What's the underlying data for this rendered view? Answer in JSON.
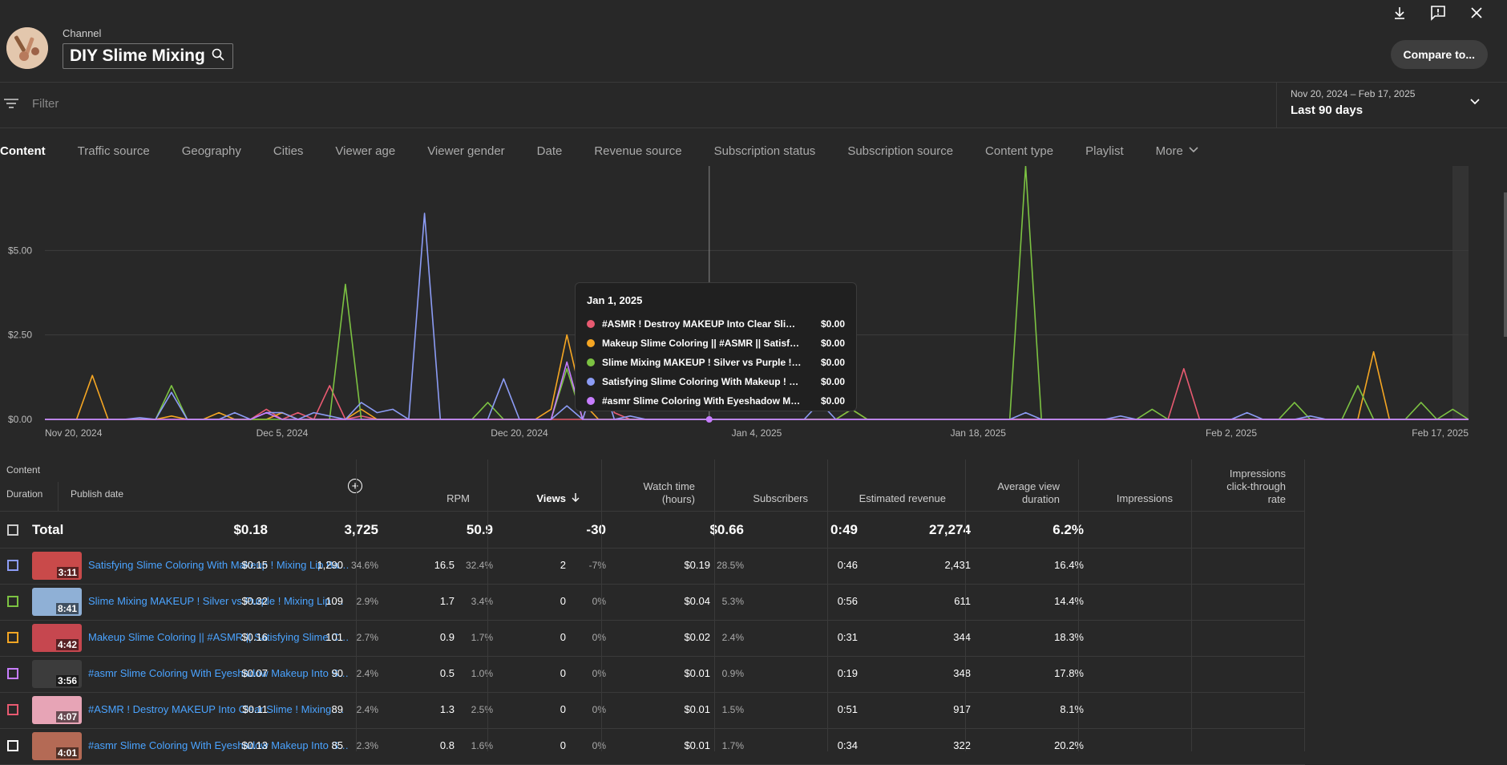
{
  "header": {
    "channel_label": "Channel",
    "channel_name": "DIY Slime Mixing",
    "compare_button": "Compare to...",
    "icons": [
      "download-icon",
      "feedback-icon",
      "close-icon"
    ]
  },
  "filter": {
    "placeholder": "Filter"
  },
  "date_range": {
    "range": "Nov 20, 2024 – Feb 17, 2025",
    "preset": "Last 90 days"
  },
  "tabs": [
    {
      "label": "Content",
      "active": true
    },
    {
      "label": "Traffic source"
    },
    {
      "label": "Geography"
    },
    {
      "label": "Cities"
    },
    {
      "label": "Viewer age"
    },
    {
      "label": "Viewer gender"
    },
    {
      "label": "Date"
    },
    {
      "label": "Revenue source"
    },
    {
      "label": "Subscription status"
    },
    {
      "label": "Subscription source"
    },
    {
      "label": "Content type"
    },
    {
      "label": "Playlist"
    },
    {
      "label": "More"
    }
  ],
  "colors": {
    "red": "#e85a71",
    "orange": "#f5a623",
    "green": "#7cc242",
    "blue": "#8c9cf5",
    "purple": "#c77dff",
    "accent": "#4aa3ff"
  },
  "chart_data": {
    "type": "line",
    "ylabel": "",
    "y_ticks": [
      "$0.00",
      "$2.50",
      "$5.00"
    ],
    "ylim": [
      0,
      7.5
    ],
    "x_ticks": [
      "Nov 20, 2024",
      "Dec 5, 2024",
      "Dec 20, 2024",
      "Jan 4, 2025",
      "Jan 18, 2025",
      "Feb 2, 2025",
      "Feb 17, 2025"
    ],
    "x_days": 90,
    "hover_day": 42,
    "grid": true,
    "series": [
      {
        "name": "#ASMR ! Destroy MAKEUP Into Clear Slime ! Mixing Makeup",
        "color": "#e85a71",
        "spikes": [
          [
            14,
            0.3
          ],
          [
            16,
            0.2
          ],
          [
            18,
            1.0
          ],
          [
            20,
            0.1
          ],
          [
            35,
            1.5
          ],
          [
            36,
            0.2
          ],
          [
            72,
            1.5
          ]
        ]
      },
      {
        "name": "Makeup Slime Coloring || #ASMR || Satisfying Slime Coloring",
        "color": "#f5a623",
        "spikes": [
          [
            3,
            1.3
          ],
          [
            8,
            0.1
          ],
          [
            11,
            0.2
          ],
          [
            15,
            0.2
          ],
          [
            20,
            0.3
          ],
          [
            32,
            0.3
          ],
          [
            33,
            2.5
          ],
          [
            34,
            0.5
          ],
          [
            51,
            0.3
          ],
          [
            84,
            2.0
          ]
        ]
      },
      {
        "name": "Slime Mixing MAKEUP ! Silver vs Purple ! Mixing Lip Balm",
        "color": "#7cc242",
        "spikes": [
          [
            8,
            1.0
          ],
          [
            19,
            4.0
          ],
          [
            28,
            0.5
          ],
          [
            33,
            1.5
          ],
          [
            51,
            0.3
          ],
          [
            62,
            7.5
          ],
          [
            70,
            0.3
          ],
          [
            79,
            0.5
          ],
          [
            83,
            1.0
          ],
          [
            87,
            0.5
          ],
          [
            89,
            0.3
          ]
        ]
      },
      {
        "name": "Satisfying Slime Coloring With Makeup ! Mixing Lip Balm",
        "color": "#8c9cf5",
        "spikes": [
          [
            6,
            0.05
          ],
          [
            8,
            0.8
          ],
          [
            12,
            0.2
          ],
          [
            14,
            0.2
          ],
          [
            15,
            0.2
          ],
          [
            17,
            0.2
          ],
          [
            18,
            0.1
          ],
          [
            20,
            0.5
          ],
          [
            21,
            0.2
          ],
          [
            22,
            0.3
          ],
          [
            24,
            6.1
          ],
          [
            29,
            1.2
          ],
          [
            33,
            0.4
          ],
          [
            35,
            1.5
          ],
          [
            37,
            0.1
          ],
          [
            49,
            0.5
          ],
          [
            62,
            0.2
          ],
          [
            68,
            0.1
          ],
          [
            76,
            0.2
          ],
          [
            80,
            0.1
          ]
        ]
      },
      {
        "name": "#asmr Slime Coloring With Eyeshadow Makeup Into Slime",
        "color": "#c77dff",
        "spikes": [
          [
            14,
            0.2
          ],
          [
            33,
            1.7
          ]
        ]
      }
    ],
    "tooltip": {
      "date": "Jan 1, 2025",
      "rows": [
        {
          "label": "#ASMR ! Destroy MAKEUP Into Clear Slime ! Mixing Makeup",
          "value": "$0.00",
          "color": "#e85a71"
        },
        {
          "label": "Makeup Slime Coloring || #ASMR || Satisfying Slime Coloring",
          "value": "$0.00",
          "color": "#f5a623"
        },
        {
          "label": "Slime Mixing MAKEUP ! Silver vs Purple ! Mixing Lip Balm",
          "value": "$0.00",
          "color": "#7cc242"
        },
        {
          "label": "Satisfying Slime Coloring With Makeup ! Mixing Lip Balm",
          "value": "$0.00",
          "color": "#8c9cf5"
        },
        {
          "label": "#asmr Slime Coloring With Eyeshadow Makeup Into Slime",
          "value": "$0.00",
          "color": "#c77dff"
        }
      ]
    }
  },
  "table": {
    "content_header": "Content",
    "duration_header": "Duration",
    "publish_header": "Publish date",
    "columns": {
      "rpm": "RPM",
      "views": "Views",
      "watch_l1": "Watch time",
      "watch_l2": "(hours)",
      "subs": "Subscribers",
      "revenue": "Estimated revenue",
      "avd_l1": "Average view",
      "avd_l2": "duration",
      "impr": "Impressions",
      "ctr_l1": "Impressions",
      "ctr_l2": "click-through",
      "ctr_l3": "rate"
    },
    "total": {
      "label": "Total",
      "rpm": "$0.18",
      "views": "3,725",
      "watch": "50.9",
      "subs": "-30",
      "revenue": "$0.66",
      "avd": "0:49",
      "impr": "27,274",
      "ctr": "6.2%"
    },
    "rows": [
      {
        "title": "Satisfying Slime Coloring With Makeup ! Mixing Lip Balm",
        "duration": "3:11",
        "color": "#8c9cf5",
        "rpm": "$0.15",
        "views": "1,290",
        "views_pct": "34.6%",
        "watch": "16.5",
        "watch_pct": "32.4%",
        "subs": "2",
        "subs_pct": "-7%",
        "revenue": "$0.19",
        "revenue_pct": "28.5%",
        "avd": "0:46",
        "impr": "2,431",
        "ctr": "16.4%"
      },
      {
        "title": "Slime Mixing MAKEUP ! Silver vs Purple ! Mixing Lip Balm",
        "duration": "8:41",
        "color": "#7cc242",
        "rpm": "$0.32",
        "views": "109",
        "views_pct": "2.9%",
        "watch": "1.7",
        "watch_pct": "3.4%",
        "subs": "0",
        "subs_pct": "0%",
        "revenue": "$0.04",
        "revenue_pct": "5.3%",
        "avd": "0:56",
        "impr": "611",
        "ctr": "14.4%"
      },
      {
        "title": "Makeup Slime Coloring || #ASMR || Satisfying Slime Coloring",
        "duration": "4:42",
        "color": "#f5a623",
        "rpm": "$0.16",
        "views": "101",
        "views_pct": "2.7%",
        "watch": "0.9",
        "watch_pct": "1.7%",
        "subs": "0",
        "subs_pct": "0%",
        "revenue": "$0.02",
        "revenue_pct": "2.4%",
        "avd": "0:31",
        "impr": "344",
        "ctr": "18.3%"
      },
      {
        "title": "#asmr Slime Coloring With Eyeshadow Makeup Into Slime",
        "duration": "3:56",
        "color": "#c77dff",
        "rpm": "$0.07",
        "views": "90",
        "views_pct": "2.4%",
        "watch": "0.5",
        "watch_pct": "1.0%",
        "subs": "0",
        "subs_pct": "0%",
        "revenue": "$0.01",
        "revenue_pct": "0.9%",
        "avd": "0:19",
        "impr": "348",
        "ctr": "17.8%"
      },
      {
        "title": "#ASMR ! Destroy MAKEUP Into Clear Slime ! Mixing Makeup",
        "duration": "4:07",
        "color": "#e85a71",
        "rpm": "$0.11",
        "views": "89",
        "views_pct": "2.4%",
        "watch": "1.3",
        "watch_pct": "2.5%",
        "subs": "0",
        "subs_pct": "0%",
        "revenue": "$0.01",
        "revenue_pct": "1.5%",
        "avd": "0:51",
        "impr": "917",
        "ctr": "8.1%"
      },
      {
        "title": "#asmr Slime Coloring With Eyeshadow Makeup Into Slime",
        "duration": "4:01",
        "color": "#ffffff",
        "rpm": "$0.13",
        "views": "85",
        "views_pct": "2.3%",
        "watch": "0.8",
        "watch_pct": "1.6%",
        "subs": "0",
        "subs_pct": "0%",
        "revenue": "$0.01",
        "revenue_pct": "1.7%",
        "avd": "0:34",
        "impr": "322",
        "ctr": "20.2%"
      }
    ]
  }
}
